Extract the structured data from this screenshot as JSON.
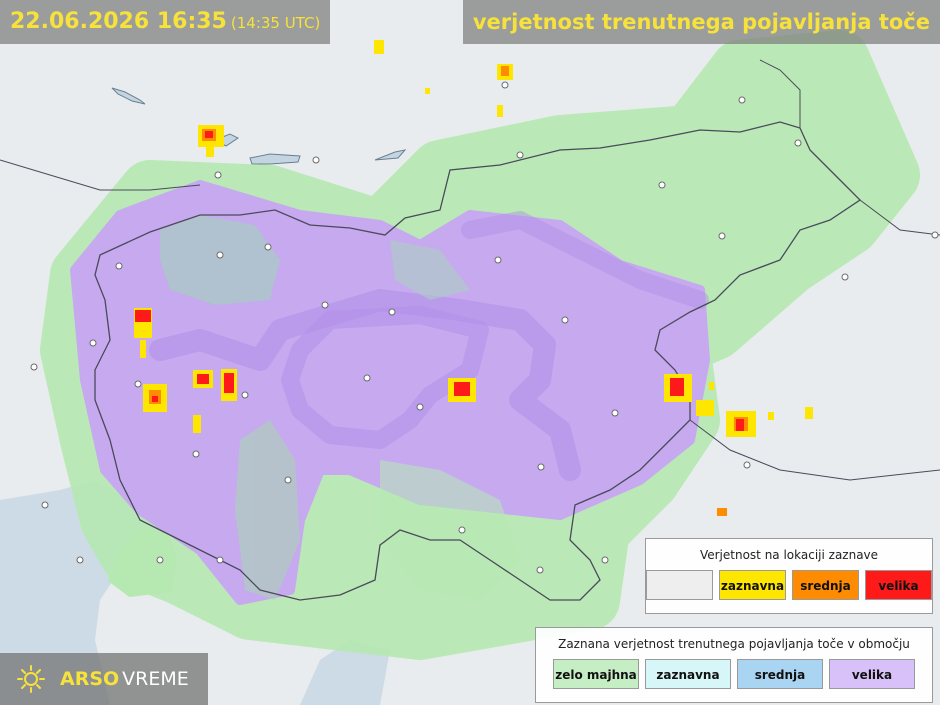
{
  "header": {
    "datetime": "22.06.2026 16:35",
    "utc": "(14:35 UTC)",
    "title": "verjetnost trenutnega pojavljanja toče"
  },
  "legend_location": {
    "title": "Verjetnost na lokaciji zaznave",
    "items": [
      {
        "label": "",
        "color": "#eeeeee"
      },
      {
        "label": "zaznavna",
        "color": "#ffe600"
      },
      {
        "label": "srednja",
        "color": "#ff8c00"
      },
      {
        "label": "velika",
        "color": "#ff1a1a"
      }
    ]
  },
  "legend_area": {
    "title": "Zaznana verjetnost trenutnega pojavljanja toče v območju",
    "items": [
      {
        "label": "zelo majhna",
        "color": "#c6eec4"
      },
      {
        "label": "zaznavna",
        "color": "#d7f6f8"
      },
      {
        "label": "srednja",
        "color": "#a9d5f2"
      },
      {
        "label": "velika",
        "color": "#d7c1f8"
      }
    ]
  },
  "brand": {
    "part1": "ARSO",
    "part2": "VREME",
    "icon": "arso-sun-icon"
  },
  "colors": {
    "land": "#e9ecee",
    "sea": "#c9d8e4",
    "border": "#4a4a5a",
    "area_low": "#b6e9b2",
    "area_high": "#c7a6f3"
  }
}
